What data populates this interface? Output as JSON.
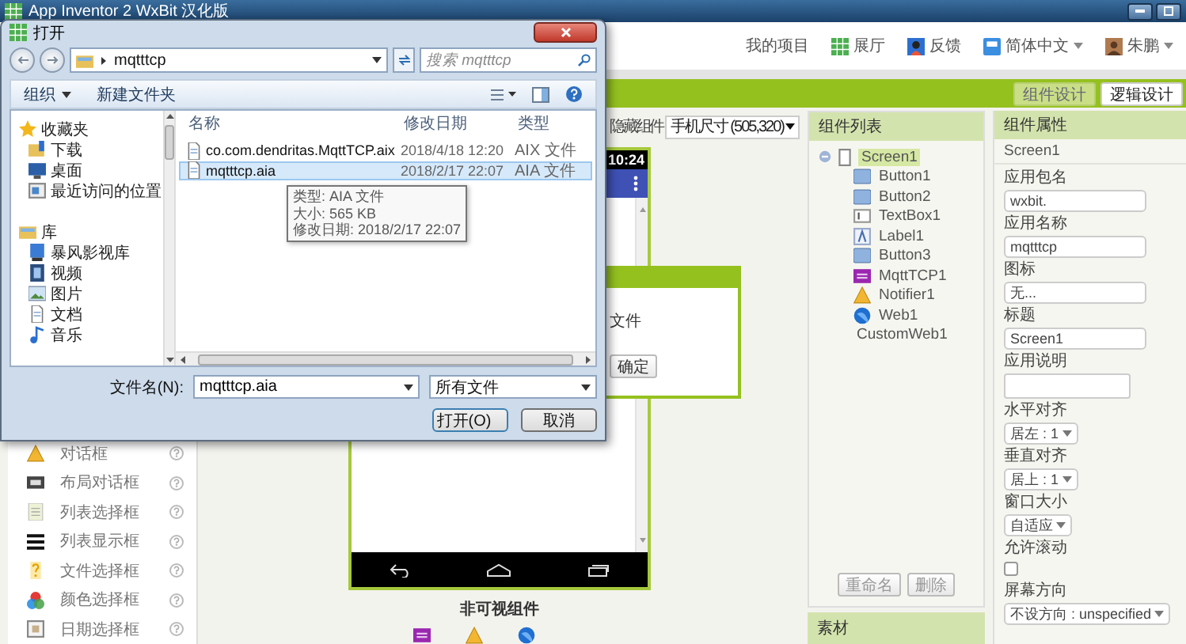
{
  "app_window": {
    "title": "App Inventor 2 WxBit 汉化版"
  },
  "top_nav": [
    {
      "label": "我的项目",
      "kind": "link",
      "dropdown": false
    },
    {
      "label": "展厅",
      "kind": "grid",
      "dropdown": false
    },
    {
      "label": "反馈",
      "kind": "feedback",
      "dropdown": false
    },
    {
      "label": "简体中文",
      "kind": "lang",
      "dropdown": true
    },
    {
      "label": "朱鹏",
      "kind": "user",
      "dropdown": true
    }
  ],
  "design_tabs": [
    {
      "label": "组件设计",
      "selected": true
    },
    {
      "label": "逻辑设计",
      "selected": false
    }
  ],
  "palette": [
    {
      "label": "对话框",
      "kind": "warning"
    },
    {
      "label": "布局对话框",
      "kind": "dialog"
    },
    {
      "label": "列表选择框",
      "kind": "listpicker"
    },
    {
      "label": "列表显示框",
      "kind": "listview"
    },
    {
      "label": "文件选择框",
      "kind": "file"
    },
    {
      "label": "颜色选择框",
      "kind": "color"
    },
    {
      "label": "日期选择框",
      "kind": "date"
    }
  ],
  "viewer": {
    "hidden_label": "隐藏组件",
    "size_select": "手机尺寸 (505,320)",
    "clock": "10:24",
    "popup": {
      "text": "文件",
      "button": "确定"
    },
    "nonvisible_title": "非可视组件",
    "nonvisible": [
      {
        "kind": "mqtt"
      },
      {
        "kind": "notifier"
      },
      {
        "kind": "web"
      }
    ]
  },
  "components": {
    "title": "组件列表",
    "tree": [
      {
        "label": "Screen1",
        "kind": "screen",
        "selected": true,
        "expanded": true,
        "children": [
          {
            "label": "Button1",
            "kind": "button",
            "selected": false
          },
          {
            "label": "Button2",
            "kind": "button",
            "selected": false
          },
          {
            "label": "TextBox1",
            "kind": "textbox",
            "selected": false
          },
          {
            "label": "Label1",
            "kind": "label",
            "selected": false
          },
          {
            "label": "Button3",
            "kind": "button",
            "selected": false
          },
          {
            "label": "MqttTCP1",
            "kind": "mqtt",
            "selected": false
          },
          {
            "label": "Notifier1",
            "kind": "notifier",
            "selected": false
          },
          {
            "label": "Web1",
            "kind": "web",
            "selected": false
          },
          {
            "label": "CustomWeb1",
            "kind": "custom",
            "selected": false
          }
        ]
      }
    ],
    "buttons": [
      "重命名",
      "删除"
    ]
  },
  "media": {
    "title": "素材"
  },
  "properties": {
    "title": "组件属性",
    "component": "Screen1",
    "items": [
      {
        "label": "应用包名",
        "kind": "text",
        "value": "wxbit."
      },
      {
        "label": "应用名称",
        "kind": "text",
        "value": "mqtttcp"
      },
      {
        "label": "图标",
        "kind": "text",
        "value": "无..."
      },
      {
        "label": "标题",
        "kind": "text",
        "value": "Screen1"
      },
      {
        "label": "应用说明",
        "kind": "textarea"
      },
      {
        "label": "水平对齐",
        "kind": "select",
        "value": "居左 : 1"
      },
      {
        "label": "垂直对齐",
        "kind": "select",
        "value": "居上 : 1"
      },
      {
        "label": "窗口大小",
        "kind": "select",
        "value": "自适应"
      },
      {
        "label": "允许滚动",
        "kind": "checkbox",
        "checked": false
      },
      {
        "label": "屏幕方向",
        "kind": "select",
        "value": "不设方向 : unspecified"
      }
    ]
  },
  "dialog": {
    "title": "打开",
    "path": "mqtttcp",
    "search_placeholder": "搜索 mqtttcp",
    "toolbar": [
      {
        "label": "组织",
        "dropdown": true
      },
      {
        "label": "新建文件夹",
        "dropdown": false
      }
    ],
    "nav": [
      {
        "label": "收藏夹",
        "kind": "star",
        "children": [
          {
            "label": "下载",
            "kind": "download"
          },
          {
            "label": "桌面",
            "kind": "desktop"
          },
          {
            "label": "最近访问的位置",
            "kind": "recent"
          }
        ]
      },
      {
        "label": "库",
        "kind": "library",
        "children": [
          {
            "label": "暴风影视库",
            "kind": "videolib"
          },
          {
            "label": "视频",
            "kind": "video"
          },
          {
            "label": "图片",
            "kind": "image"
          },
          {
            "label": "文档",
            "kind": "doc"
          },
          {
            "label": "音乐",
            "kind": "music"
          }
        ]
      }
    ],
    "columns": [
      "名称",
      "修改日期",
      "类型"
    ],
    "files": [
      {
        "name": "co.com.dendritas.MqttTCP.aix",
        "date": "2018/4/18 12:20",
        "type": "AIX 文件",
        "selected": false
      },
      {
        "name": "mqtttcp.aia",
        "date": "2018/2/17 22:07",
        "type": "AIA 文件",
        "selected": true
      }
    ],
    "tooltip": [
      "类型: AIA 文件",
      "大小: 565 KB",
      "修改日期: 2018/2/17 22:07"
    ],
    "filename_label": "文件名(N):",
    "filename": "mqtttcp.aia",
    "filter": "所有文件",
    "buttons": [
      {
        "label": "打开(O)",
        "kind": "split"
      },
      {
        "label": "取消",
        "kind": "plain"
      }
    ]
  }
}
